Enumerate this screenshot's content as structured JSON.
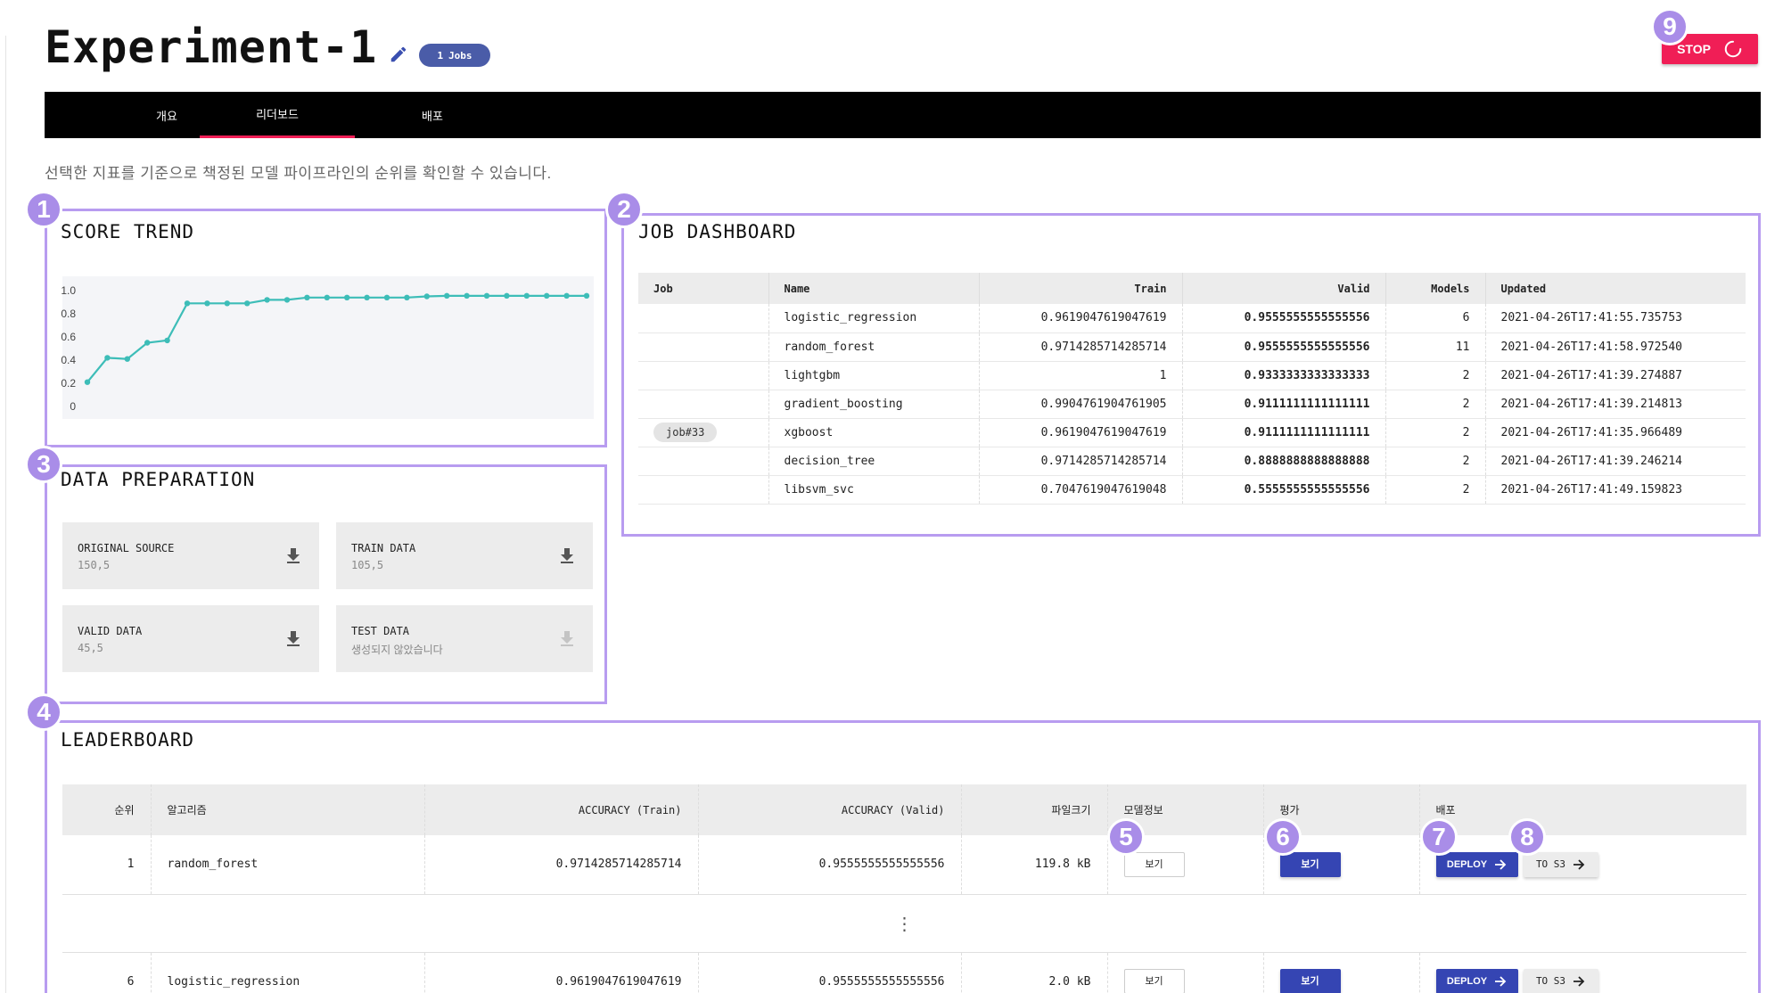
{
  "header": {
    "title": "Experiment-1",
    "jobs_badge_count": "1",
    "jobs_badge_label": "Jobs",
    "stop_label": "STOP"
  },
  "tabs": [
    {
      "label": "개요"
    },
    {
      "label": "리더보드",
      "active": true
    },
    {
      "label": "배포"
    }
  ],
  "description": "선택한 지표를 기준으로 책정된 모델 파이프라인의 순위를 확인할 수 있습니다.",
  "markers": [
    "1",
    "2",
    "3",
    "4",
    "5",
    "6",
    "7",
    "8",
    "9"
  ],
  "score_trend": {
    "title": "SCORE TREND",
    "chart_data": {
      "type": "line",
      "title": "",
      "xlabel": "",
      "ylabel": "",
      "ylim": [
        0,
        1.0
      ],
      "yticks": [
        "1.0",
        "0.8",
        "0.6",
        "0.4",
        "0.2",
        "0"
      ],
      "grid": false,
      "color": "#3dbdb8",
      "series": [
        {
          "values": [
            0.21,
            0.42,
            0.41,
            0.55,
            0.57,
            0.89,
            0.89,
            0.89,
            0.89,
            0.92,
            0.92,
            0.94,
            0.94,
            0.94,
            0.94,
            0.94,
            0.94,
            0.95,
            0.955,
            0.955,
            0.955,
            0.955,
            0.955,
            0.955,
            0.955,
            0.955
          ]
        }
      ]
    }
  },
  "data_preparation": {
    "title": "DATA PREPARATION",
    "cards": [
      {
        "name": "ORIGINAL SOURCE",
        "value": "150,5"
      },
      {
        "name": "TRAIN DATA",
        "value": "105,5"
      },
      {
        "name": "VALID DATA",
        "value": "45,5"
      },
      {
        "name": "TEST DATA",
        "value": "생성되지 않았습니다"
      }
    ]
  },
  "job_dashboard": {
    "title": "JOB DASHBOARD",
    "columns": [
      "Job",
      "Name",
      "Train",
      "Valid",
      "Models",
      "Updated"
    ],
    "job_chip": "job#33",
    "rows": [
      {
        "name": "logistic_regression",
        "train": "0.9619047619047619",
        "valid": "0.9555555555555556",
        "models": "6",
        "updated": "2021-04-26T17:41:55.735753"
      },
      {
        "name": "random_forest",
        "train": "0.9714285714285714",
        "valid": "0.9555555555555556",
        "models": "11",
        "updated": "2021-04-26T17:41:58.972540"
      },
      {
        "name": "lightgbm",
        "train": "1",
        "valid": "0.9333333333333333",
        "models": "2",
        "updated": "2021-04-26T17:41:39.274887"
      },
      {
        "name": "gradient_boosting",
        "train": "0.9904761904761905",
        "valid": "0.9111111111111111",
        "models": "2",
        "updated": "2021-04-26T17:41:39.214813"
      },
      {
        "name": "xgboost",
        "train": "0.9619047619047619",
        "valid": "0.9111111111111111",
        "models": "2",
        "updated": "2021-04-26T17:41:35.966489"
      },
      {
        "name": "decision_tree",
        "train": "0.9714285714285714",
        "valid": "0.8888888888888888",
        "models": "2",
        "updated": "2021-04-26T17:41:39.246214"
      },
      {
        "name": "libsvm_svc",
        "train": "0.7047619047619048",
        "valid": "0.5555555555555556",
        "models": "2",
        "updated": "2021-04-26T17:41:49.159823"
      }
    ]
  },
  "leaderboard": {
    "title": "LEADERBOARD",
    "columns": [
      "순위",
      "알고리즘",
      "ACCURACY (Train)",
      "ACCURACY (Valid)",
      "파일크기",
      "모델정보",
      "평가",
      "배포"
    ],
    "view_label": "보기",
    "deploy_label": "DEPLOY",
    "s3_label": "TO S3",
    "more_indicator": "⋮",
    "rows": [
      {
        "rank": "1",
        "algorithm": "random_forest",
        "train": "0.9714285714285714",
        "valid": "0.9555555555555556",
        "size": "119.8 kB"
      },
      {
        "rank": "6",
        "algorithm": "logistic_regression",
        "train": "0.9619047619047619",
        "valid": "0.9555555555555556",
        "size": "2.0 kB"
      }
    ]
  },
  "colors": {
    "accent_pink": "#f01e56",
    "primary_blue": "#3545b3",
    "marker_purple": "#a98de8",
    "panel_border": "#b89cf0",
    "line_teal": "#3dbdb8"
  }
}
